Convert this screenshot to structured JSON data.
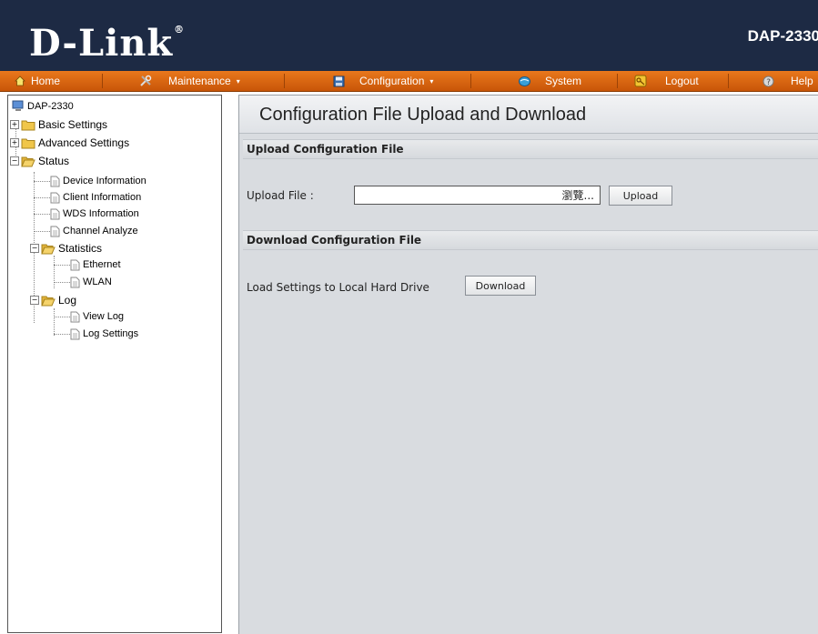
{
  "header": {
    "logo": "D-Link",
    "logo_mark": "®",
    "model": "DAP-2330"
  },
  "menu": [
    {
      "label": "Home",
      "icon": "home-icon"
    },
    {
      "label": "Maintenance",
      "icon": "tools-icon",
      "dropdown": "▾"
    },
    {
      "label": "Configuration",
      "icon": "save-disk-icon",
      "dropdown": "▾"
    },
    {
      "label": "System",
      "icon": "globe-icon"
    },
    {
      "label": "Logout",
      "icon": "key-icon"
    },
    {
      "label": "Help",
      "icon": "help-icon"
    }
  ],
  "tree": {
    "root": "DAP-2330",
    "basic": "Basic Settings",
    "advanced": "Advanced Settings",
    "status": "Status",
    "device_info": "Device Information",
    "client_info": "Client Information",
    "wds_info": "WDS Information",
    "channel_analyze": "Channel Analyze",
    "statistics": "Statistics",
    "ethernet": "Ethernet",
    "wlan": "WLAN",
    "log": "Log",
    "view_log": "View Log",
    "log_settings": "Log Settings"
  },
  "page": {
    "title": "Configuration File Upload and Download",
    "upload_section": "Upload Configuration File",
    "upload_file_label": "Upload File :",
    "browse_label": "瀏覽...",
    "upload_button": "Upload",
    "download_section": "Download Configuration File",
    "load_settings_label": "Load Settings to Local Hard Drive",
    "download_button": "Download"
  }
}
